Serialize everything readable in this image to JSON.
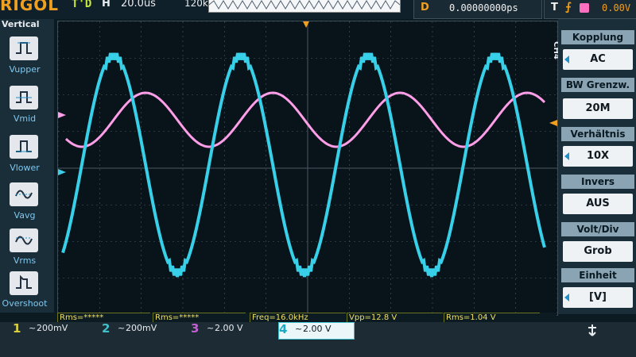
{
  "header": {
    "brand": "RIGOL",
    "run_state": "T'D",
    "timebase_label": "H",
    "timebase_value": "20.0us",
    "sample_rate": "120k pts",
    "delay_label": "D",
    "delay_value": "0.00000000ps",
    "trigger_label": "T",
    "trigger_level": "0.00V"
  },
  "left_menu": {
    "title": "Vertical",
    "items": [
      {
        "label": "Vupper",
        "icon": "vupper-icon"
      },
      {
        "label": "Vmid",
        "icon": "vmid-icon"
      },
      {
        "label": "Vlower",
        "icon": "vlower-icon"
      },
      {
        "label": "Vavg",
        "icon": "vavg-icon"
      },
      {
        "label": "Vrms",
        "icon": "vrms-icon"
      },
      {
        "label": "Overshoot",
        "icon": "overshoot-icon"
      }
    ]
  },
  "right_menu": {
    "channel_tag": "CH4",
    "items": [
      {
        "label": "Kopplung",
        "value": "AC"
      },
      {
        "label": "BW Grenzw.",
        "value": "20M"
      },
      {
        "label": "Verhältnis",
        "value": "10X"
      },
      {
        "label": "Invers",
        "value": "AUS"
      },
      {
        "label": "Volt/Div",
        "value": "Grob"
      },
      {
        "label": "Einheit",
        "value": "[V]"
      }
    ]
  },
  "measurements": [
    {
      "text": "Rms=*****"
    },
    {
      "text": "Rms=*****"
    },
    {
      "text": "Freq=16.0kHz"
    },
    {
      "text": "Vpp=12.8 V"
    },
    {
      "text": "Rms=1.04 V"
    }
  ],
  "channels": [
    {
      "number": "1",
      "coupling": "~",
      "scale": "200mV",
      "color": "#d8d040"
    },
    {
      "number": "2",
      "coupling": "~",
      "scale": "200mV",
      "color": "#40c0c8"
    },
    {
      "number": "3",
      "coupling": "~",
      "scale": "2.00 V",
      "color": "#c060d0"
    },
    {
      "number": "4",
      "coupling": "~",
      "scale": "2.00 V",
      "color": "#40c8e0"
    }
  ],
  "colors": {
    "ch3_trace": "#ff9ee8",
    "ch4_trace": "#38d0e8",
    "grid": "#4a5a62",
    "brand": "#f0a020"
  }
}
